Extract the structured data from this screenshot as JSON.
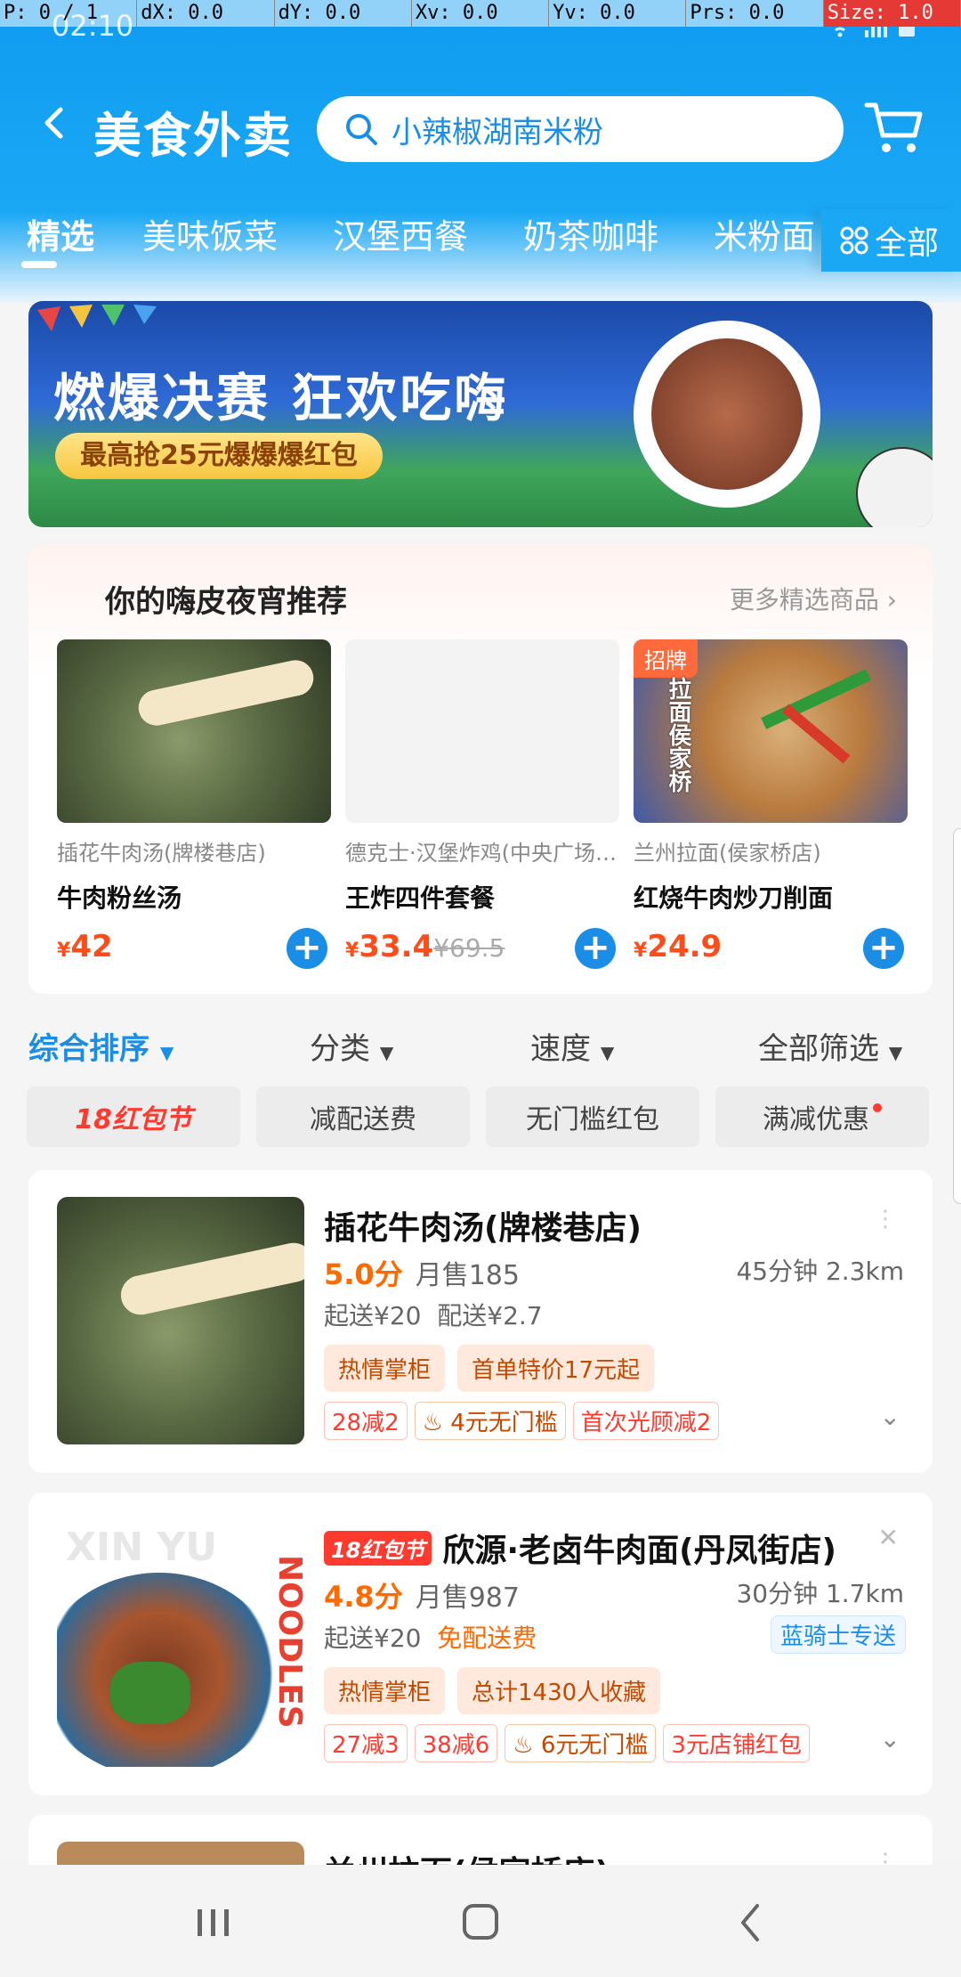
{
  "debug": {
    "p": "P: 0 / 1",
    "dx": "dX: 0.0",
    "dy": "dY: 0.0",
    "xv": "Xv: 0.0",
    "yv": "Yv: 0.0",
    "prs": "Prs: 0.0",
    "size": "Size: 1.0"
  },
  "status": {
    "time": "02:10"
  },
  "header": {
    "title": "美食外卖",
    "search_text": "小辣椒湖南米粉",
    "tabs": [
      "精选",
      "美味饭菜",
      "汉堡西餐",
      "奶茶咖啡",
      "米粉面"
    ],
    "all_label": "全部"
  },
  "banner": {
    "title": "燃爆决赛 狂欢吃嗨",
    "subtitle": "最高抢25元爆爆爆红包"
  },
  "recommend": {
    "title": "你的嗨皮夜宵推荐",
    "more": "更多精选商品",
    "items": [
      {
        "shop": "插花牛肉汤(牌楼巷店)",
        "name": "牛肉粉丝汤",
        "currency": "¥",
        "price": "42",
        "old_price": ""
      },
      {
        "shop": "德克士·汉堡炸鸡(中央广场…",
        "name": "王炸四件套餐",
        "currency": "¥",
        "price": "33.4",
        "old_price": "¥69.5"
      },
      {
        "shop": "兰州拉面(侯家桥店)",
        "name": "红烧牛肉炒刀削面",
        "currency": "¥",
        "price": "24.9",
        "old_price": "",
        "badge": "招牌",
        "img_text": "拉面侯家桥"
      }
    ]
  },
  "sort": {
    "items": [
      "综合排序",
      "分类",
      "速度",
      "全部筛选"
    ]
  },
  "filters": [
    "18红包节",
    "减配送费",
    "无门槛红包",
    "满减优惠"
  ],
  "shops": [
    {
      "name": "插花牛肉汤(牌楼巷店)",
      "rating": "5.0分",
      "sales": "月售185",
      "time_distance": "45分钟 2.3km",
      "min_order": "起送¥20",
      "delivery": "配送¥2.7",
      "tags": [
        "热情掌柜",
        "首单特价17元起"
      ],
      "promos": [
        "28减2",
        "4元无门槛",
        "首次光顾减2"
      ]
    },
    {
      "badge": "18红包节",
      "name": "欣源·老卤牛肉面(丹凤街店)",
      "rating": "4.8分",
      "sales": "月售987",
      "time_distance": "30分钟 1.7km",
      "min_order": "起送¥20",
      "delivery": "免配送费",
      "rider": "蓝骑士专送",
      "tags": [
        "热情掌柜",
        "总计1430人收藏"
      ],
      "promos": [
        "27减3",
        "38减6",
        "6元无门槛",
        "3元店铺红包"
      ],
      "img_text_top": "XIN YU",
      "img_text_side": "NOODLES"
    },
    {
      "name": "兰州拉面(侯家桥店)"
    }
  ]
}
